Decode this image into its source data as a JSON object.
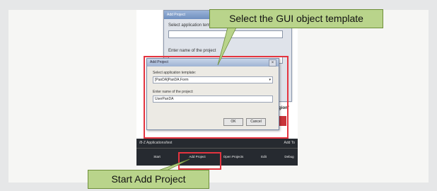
{
  "callouts": {
    "top": "Select the GUI object template",
    "bottom": "Start Add Project"
  },
  "back_window": {
    "title": "Add Project",
    "label1": "Select application template",
    "label2": "Enter name of the project"
  },
  "dialog": {
    "title": "Add Project",
    "template_label": "Select application template:",
    "template_value": "[PanDA]PanDA.Form",
    "name_label": "Enter name of the project:",
    "name_value": "UserPanDA",
    "ok_button": "OK",
    "cancel_button": "Cancel"
  },
  "side_text": {
    "prefix": "\"",
    "bold": "SetRegion",
    "suffix": "\""
  },
  "toolbar": {
    "path": "/8-Z Applications/test",
    "right_label": "Add To",
    "items": [
      "Start",
      "Add Project",
      "Open Projects",
      "Edit",
      "Debug"
    ]
  },
  "colors": {
    "highlight": "#e4343f",
    "callout_bg": "#b9d48b"
  }
}
